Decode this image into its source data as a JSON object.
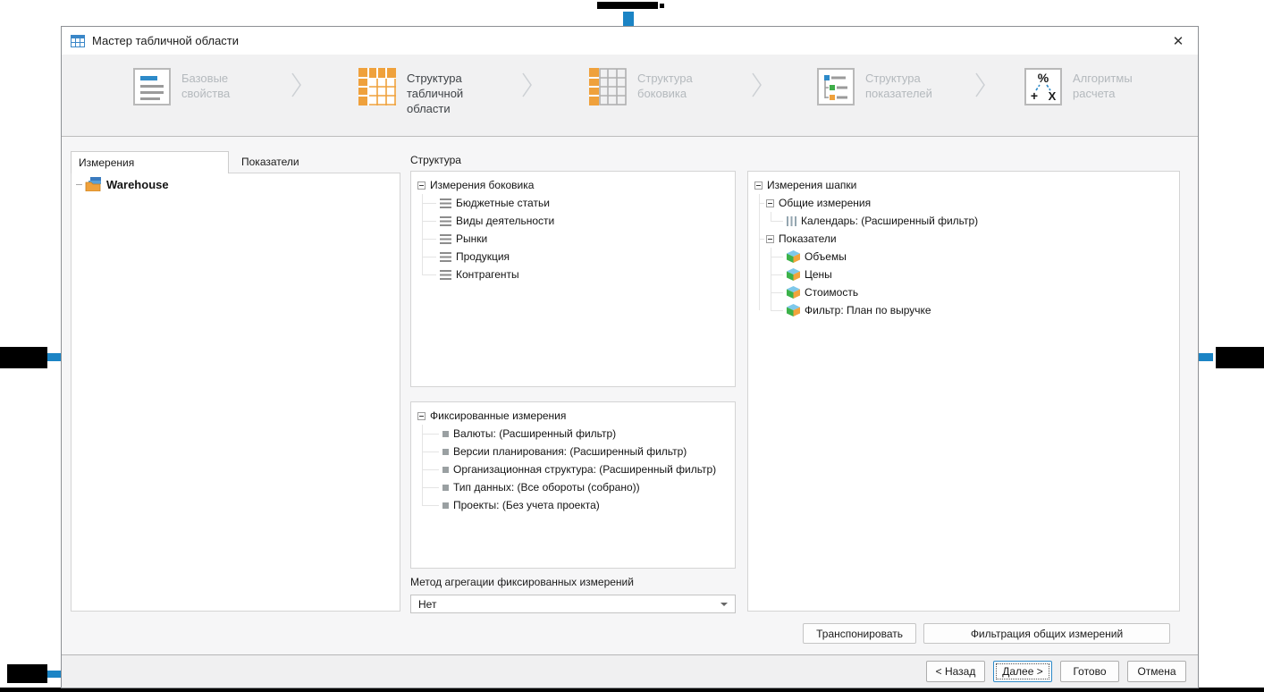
{
  "window": {
    "title": "Мастер табличной области",
    "close_glyph": "✕"
  },
  "steps": [
    {
      "label": "Базовые свойства",
      "active": false
    },
    {
      "label": "Структура табличной области",
      "active": true
    },
    {
      "label": "Структура боковика",
      "active": false
    },
    {
      "label": "Структура показателей",
      "active": false
    },
    {
      "label": "Алгоритмы расчета",
      "active": false
    }
  ],
  "left_panel": {
    "tabs": [
      {
        "label": "Измерения"
      },
      {
        "label": "Показатели"
      }
    ],
    "tree": [
      {
        "label": "Warehouse"
      }
    ]
  },
  "structure": {
    "label": "Структура",
    "side_dimensions": {
      "label": "Измерения боковика",
      "items": [
        "Бюджетные статьи",
        "Виды деятельности",
        "Рынки",
        "Продукция",
        "Контрагенты"
      ]
    },
    "fixed_dimensions": {
      "label": "Фиксированные измерения",
      "items": [
        "Валюты: (Расширенный фильтр)",
        "Версии планирования: (Расширенный фильтр)",
        "Организационная структура: (Расширенный фильтр)",
        "Тип данных: (Все обороты (собрано))",
        "Проекты: (Без учета проекта)"
      ]
    },
    "aggregation": {
      "label": "Метод агрегации фиксированных измерений",
      "value": "Нет"
    }
  },
  "header_panel": {
    "root_label": "Измерения шапки",
    "common": {
      "label": "Общие измерения",
      "items": [
        "Календарь: (Расширенный фильтр)"
      ]
    },
    "indicators": {
      "label": "Показатели",
      "items": [
        "Объемы",
        "Цены",
        "Стоимость",
        "Фильтр: План по выручке"
      ]
    }
  },
  "actions": {
    "transpose": "Транспонировать",
    "filter_common": "Фильтрация общих измерений"
  },
  "footer": {
    "back": "< Назад",
    "next": "Далее >",
    "finish": "Готово",
    "cancel": "Отмена"
  },
  "colors": {
    "marker_blue": "#1b84c5",
    "accent_orange": "#efa13c",
    "brand_blue": "#2d8ac9"
  }
}
